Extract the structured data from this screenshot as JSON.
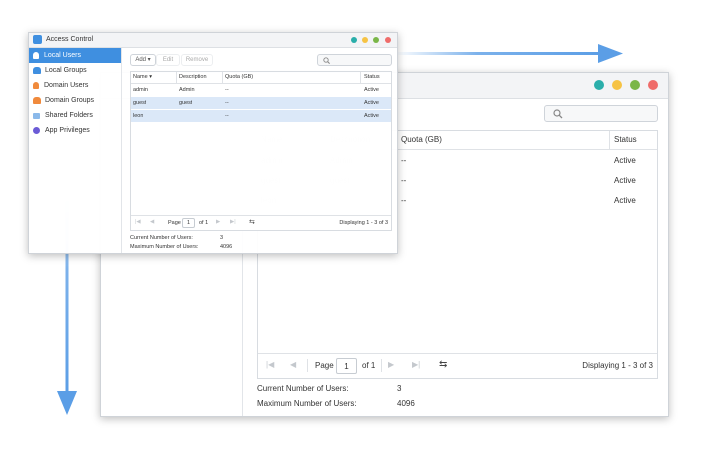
{
  "window": {
    "title": "Access Control"
  },
  "colors": {
    "accent": "#3f8fe0",
    "arrow": "#5b9ee6",
    "dot_teal": "#2aaeaa",
    "dot_yellow": "#f6c344",
    "dot_green": "#7ab648",
    "dot_red": "#ef6c6a"
  },
  "sidebar": {
    "items": [
      {
        "label": "Local Users",
        "icon": "user-icon",
        "active": true
      },
      {
        "label": "Local Groups",
        "icon": "group-icon",
        "active": false
      },
      {
        "label": "Domain Users",
        "icon": "domain-user-icon",
        "active": false
      },
      {
        "label": "Domain Groups",
        "icon": "domain-group-icon",
        "active": false
      },
      {
        "label": "Shared Folders",
        "icon": "folder-icon",
        "active": false
      },
      {
        "label": "App Privileges",
        "icon": "app-privileges-icon",
        "active": false
      }
    ]
  },
  "toolbar": {
    "add_label": "Add",
    "edit_label": "Edit",
    "remove_label": "Remove",
    "search_placeholder": ""
  },
  "table": {
    "columns": [
      "Name",
      "Description",
      "Quota (GB)",
      "Status"
    ],
    "rows": [
      {
        "name": "admin",
        "description": "Admin",
        "quota": "--",
        "status": "Active"
      },
      {
        "name": "guest",
        "description": "guest",
        "quota": "--",
        "status": "Active"
      },
      {
        "name": "leon",
        "description": "",
        "quota": "--",
        "status": "Active"
      }
    ]
  },
  "pager": {
    "page_label": "Page",
    "page_value": "1",
    "of_label": "of 1",
    "displaying": "Displaying 1 - 3 of 3"
  },
  "footer": {
    "current_users_label": "Current Number of Users:",
    "current_users_value": "3",
    "max_users_label": "Maximum Number of Users:",
    "max_users_value": "4096"
  }
}
